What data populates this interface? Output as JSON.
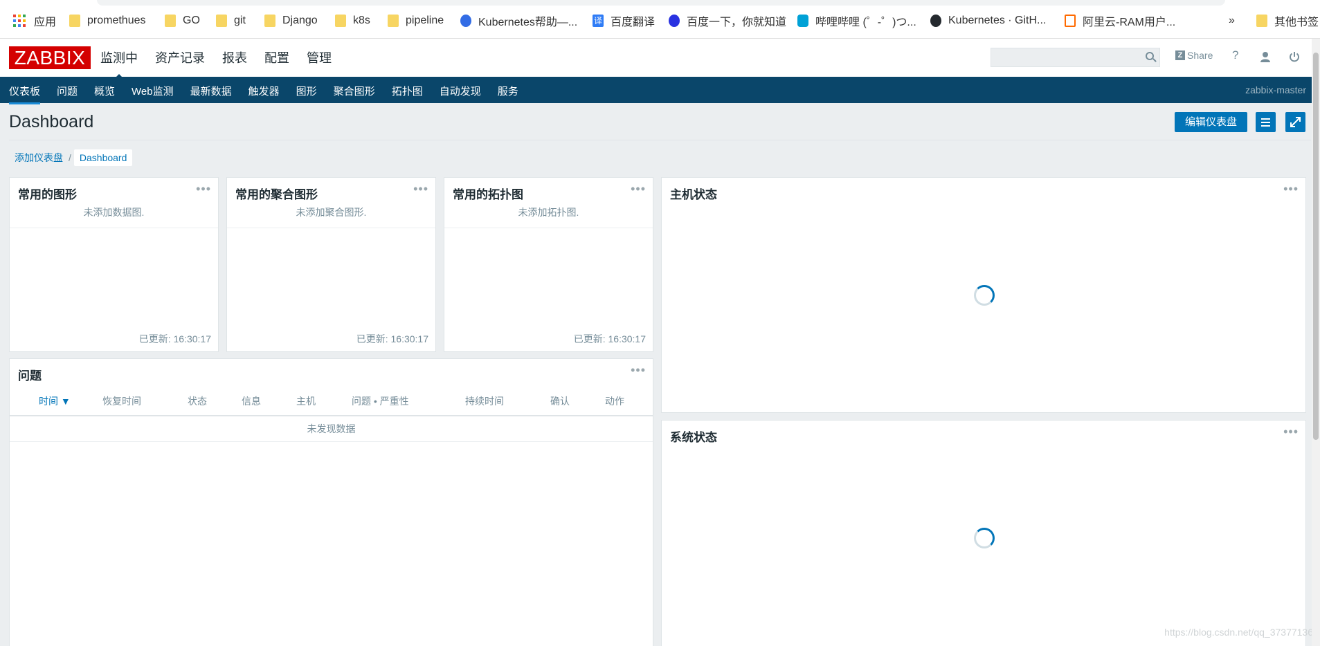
{
  "bookmarks": {
    "apps_label": "应用",
    "items": [
      {
        "label": "promethues",
        "icon": "folder-icon"
      },
      {
        "label": "GO",
        "icon": "folder-icon"
      },
      {
        "label": "git",
        "icon": "folder-icon"
      },
      {
        "label": "Django",
        "icon": "folder-icon"
      },
      {
        "label": "k8s",
        "icon": "folder-icon"
      },
      {
        "label": "pipeline",
        "icon": "folder-icon"
      },
      {
        "label": "Kubernetes帮助—...",
        "icon": "kubernetes-icon"
      },
      {
        "label": "百度翻译",
        "icon": "baidu-translate-icon"
      },
      {
        "label": "百度一下，你就知道",
        "icon": "baidu-paw-icon"
      },
      {
        "label": "哔哩哔哩 (゜-゜)つ...",
        "icon": "bilibili-icon"
      },
      {
        "label": "Kubernetes · GitH...",
        "icon": "github-icon"
      },
      {
        "label": "阿里云-RAM用户...",
        "icon": "aliyun-icon"
      }
    ],
    "more": "»",
    "other": "其他书签"
  },
  "header": {
    "logo": "ZABBIX",
    "nav": [
      "监测中",
      "资产记录",
      "报表",
      "配置",
      "管理"
    ],
    "active_nav": "监测中",
    "share": "Share",
    "help": "?"
  },
  "subnav": {
    "items": [
      "仪表板",
      "问题",
      "概览",
      "Web监测",
      "最新数据",
      "触发器",
      "图形",
      "聚合图形",
      "拓扑图",
      "自动发现",
      "服务"
    ],
    "active": "仪表板",
    "host": "zabbix-master"
  },
  "page": {
    "title": "Dashboard",
    "edit_button": "编辑仪表盘",
    "breadcrumb_parent": "添加仪表盘",
    "breadcrumb_sep": "/",
    "breadcrumb_current": "Dashboard"
  },
  "widgets": {
    "graphs": {
      "title": "常用的图形",
      "message": "未添加数据图.",
      "updated": "已更新: 16:30:17"
    },
    "screens": {
      "title": "常用的聚合图形",
      "message": "未添加聚合图形.",
      "updated": "已更新: 16:30:17"
    },
    "maps": {
      "title": "常用的拓扑图",
      "message": "未添加拓扑图.",
      "updated": "已更新: 16:30:17"
    },
    "host_status": {
      "title": "主机状态"
    },
    "problems": {
      "title": "问题",
      "columns": [
        "时间 ▼",
        "恢复时间",
        "状态",
        "信息",
        "主机",
        "问题 • 严重性",
        "持续时间",
        "确认",
        "动作"
      ],
      "empty": "未发现数据"
    },
    "system_status": {
      "title": "系统状态"
    },
    "menu": "•••"
  },
  "watermark": "https://blog.csdn.net/qq_37377136",
  "colors": {
    "brand": "#d40000",
    "nav": "#0a466a",
    "accent": "#0275b8"
  }
}
